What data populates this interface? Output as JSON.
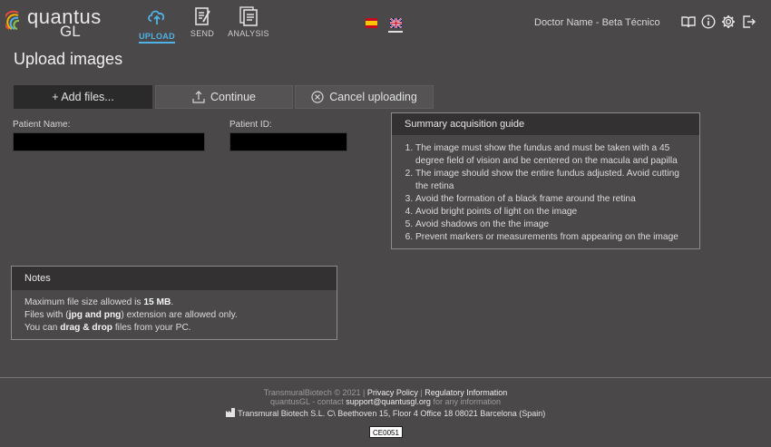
{
  "header": {
    "logo_word": "quantus",
    "logo_sub": "GL",
    "tabs": [
      {
        "label": "UPLOAD",
        "icon": "cloud-upload-icon",
        "active": true
      },
      {
        "label": "SEND",
        "icon": "send-document-icon",
        "active": false
      },
      {
        "label": "ANALYSIS",
        "icon": "analysis-document-icon",
        "active": false
      }
    ],
    "languages": [
      "es",
      "en"
    ],
    "doctor_name": "Doctor Name - Beta Técnico",
    "icons": [
      "book-icon",
      "info-icon",
      "settings-gear-icon",
      "logout-icon"
    ]
  },
  "page": {
    "title": "Upload images"
  },
  "toolbar": {
    "add_label": "+ Add files...",
    "continue_label": "Continue",
    "cancel_label": "Cancel uploading"
  },
  "form": {
    "patient_name_label": "Patient Name:",
    "patient_name_value": "",
    "patient_id_label": "Patient ID:",
    "patient_id_value": ""
  },
  "guide": {
    "title": "Summary acquisition guide",
    "items": [
      "The image must show the fundus and must be taken with a 45 degree field of vision and be centered on the macula and papilla",
      "The image should show the entire fundus adjusted. Avoid cutting the retina",
      "Avoid the formation of a black frame around the retina",
      "Avoid bright points of light on the image",
      "Avoid shadows on the the image",
      "Prevent markers or measurements from appearing on the image"
    ]
  },
  "notes": {
    "title": "Notes",
    "line1_a": "Maximum file size allowed is ",
    "line1_b": "15 MB",
    "line1_c": ".",
    "line2_a": "Files with (",
    "line2_b": "jpg and png",
    "line2_c": ") extension are allowed only.",
    "line3_a": "You can ",
    "line3_b": "drag & drop",
    "line3_c": " files from your PC."
  },
  "footer": {
    "copyright": "TransmuralBiotech © 2021 | ",
    "privacy": "Privacy Policy",
    "sep": " | ",
    "regulatory": "Regulatory Information",
    "contact_prefix": "quantusGL - contact ",
    "email": "support@quantusgl.org",
    "contact_suffix": " for any information",
    "address": "Transmural Biotech S.L. C\\ Beethoven 15, Floor 4 Office 18 08021 Barcelona (Spain)",
    "ce_mark": "CE0051"
  },
  "colors": {
    "background": "#4a4848",
    "accent": "#4fb3e8",
    "panel_header": "#333131"
  }
}
